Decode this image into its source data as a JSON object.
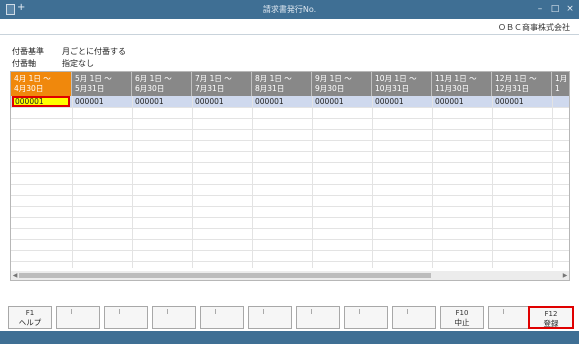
{
  "window": {
    "title": "請求書発行No."
  },
  "company": "ＯＢＣ商事株式会社",
  "info": {
    "numbering_basis_label": "付番基準",
    "numbering_basis_value": "月ごとに付番する",
    "numbering_axis_label": "付番軸",
    "numbering_axis_value": "指定なし"
  },
  "grid": {
    "columns": [
      {
        "line1": "4月 1日 ～",
        "line2": "4月30日"
      },
      {
        "line1": "5月 1日 ～",
        "line2": "5月31日"
      },
      {
        "line1": "6月 1日 ～",
        "line2": "6月30日"
      },
      {
        "line1": "7月 1日 ～",
        "line2": "7月31日"
      },
      {
        "line1": "8月 1日 ～",
        "line2": "8月31日"
      },
      {
        "line1": "9月 1日 ～",
        "line2": "9月30日"
      },
      {
        "line1": "10月 1日 ～",
        "line2": "10月31日"
      },
      {
        "line1": "11月 1日 ～",
        "line2": "11月30日"
      },
      {
        "line1": "12月 1日 ～",
        "line2": "12月31日"
      },
      {
        "line1": "1月",
        "line2": "1"
      }
    ],
    "row": [
      "000001",
      "000001",
      "000001",
      "000001",
      "000001",
      "000001",
      "000001",
      "000001",
      "000001",
      ""
    ]
  },
  "fkeys": [
    {
      "key": "F1",
      "label": "ヘルプ"
    },
    {
      "key": "",
      "label": ""
    },
    {
      "key": "",
      "label": ""
    },
    {
      "key": "",
      "label": ""
    },
    {
      "key": "",
      "label": ""
    },
    {
      "key": "",
      "label": ""
    },
    {
      "key": "",
      "label": ""
    },
    {
      "key": "",
      "label": ""
    },
    {
      "key": "",
      "label": ""
    },
    {
      "key": "F10",
      "label": "中止"
    },
    {
      "key": "",
      "label": ""
    },
    {
      "key": "F12",
      "label": "登録"
    }
  ]
}
